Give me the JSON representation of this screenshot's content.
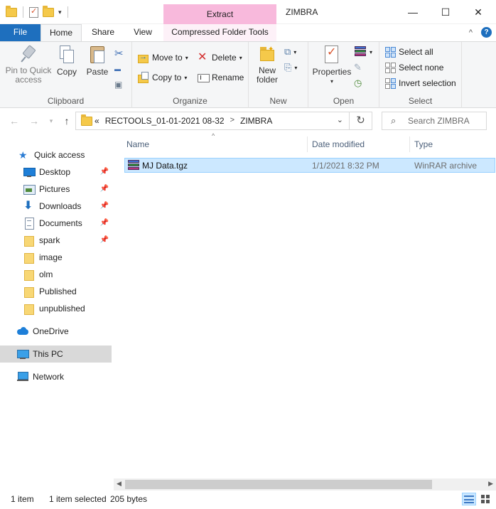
{
  "window": {
    "title": "ZIMBRA",
    "context_header": "Extract",
    "controls": {
      "minimize": "—",
      "maximize": "☐",
      "close": "✕"
    }
  },
  "ribbon_tabs": {
    "file": "File",
    "home": "Home",
    "share": "Share",
    "view": "View",
    "compressed": "Compressed Folder Tools",
    "expand_glyph": "^",
    "help_glyph": "?"
  },
  "clipboard": {
    "label": "Clipboard",
    "pin": "Pin to Quick\naccess",
    "copy": "Copy",
    "paste": "Paste"
  },
  "organize": {
    "label": "Organize",
    "move_to": "Move to",
    "copy_to": "Copy to",
    "delete": "Delete",
    "rename": "Rename"
  },
  "new_group": {
    "label": "New",
    "new_folder": "New\nfolder"
  },
  "open_group": {
    "label": "Open",
    "properties": "Properties"
  },
  "select_group": {
    "label": "Select",
    "select_all": "Select all",
    "select_none": "Select none",
    "invert_selection": "Invert selection"
  },
  "address": {
    "prefix": "«",
    "segments": [
      "RECTOOLS_01-01-2021 08-32",
      "ZIMBRA"
    ],
    "separator": ">"
  },
  "search": {
    "placeholder": "Search ZIMBRA"
  },
  "nav_pane": {
    "quick_access": "Quick access",
    "items": [
      "Desktop",
      "Pictures",
      "Downloads",
      "Documents",
      "spark",
      "image",
      "olm",
      "Published",
      "unpublished"
    ],
    "onedrive": "OneDrive",
    "this_pc": "This PC",
    "network": "Network"
  },
  "columns": {
    "name": "Name",
    "date": "Date modified",
    "type": "Type"
  },
  "files": [
    {
      "name": "MJ Data.tgz",
      "date": "1/1/2021 8:32 PM",
      "type": "WinRAR archive"
    }
  ],
  "status": {
    "count": "1 item",
    "selected": "1 item selected",
    "size": "205 bytes"
  }
}
